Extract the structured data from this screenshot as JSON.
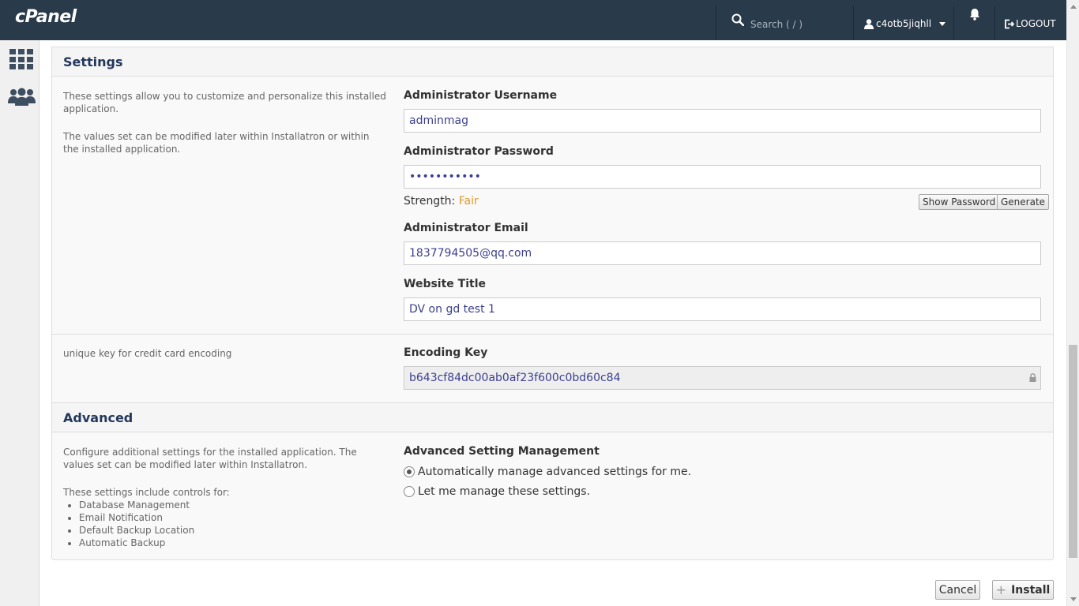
{
  "topbar": {
    "logo": "cPanel",
    "search_placeholder": "Search ( / )",
    "username": "c4otb5jiqhll",
    "logout_label": "LOGOUT"
  },
  "settings": {
    "heading": "Settings",
    "desc_1": "These settings allow you to customize and personalize this installed application.",
    "desc_2": "The values set can be modified later within Installatron or within the installed application.",
    "admin_username_label": "Administrator Username",
    "admin_username_value": "adminmag",
    "admin_password_label": "Administrator Password",
    "admin_password_value": "•••••••••••",
    "strength_label": "Strength:",
    "strength_value": "Fair",
    "show_password_label": "Show Password",
    "generate_label": "Generate",
    "admin_email_label": "Administrator Email",
    "admin_email_value": "1837794505@qq.com",
    "website_title_label": "Website Title",
    "website_title_value": "DV on gd test 1",
    "encoding_desc": "unique key for credit card encoding",
    "encoding_key_label": "Encoding Key",
    "encoding_key_value": "b643cf84dc00ab0af23f600c0bd60c84"
  },
  "advanced": {
    "heading": "Advanced",
    "desc_1": "Configure additional settings for the installed application. The values set can be modified later within Installatron.",
    "desc_2": "These settings include controls for:",
    "items": [
      "Database Management",
      "Email Notification",
      "Default Backup Location",
      "Automatic Backup"
    ],
    "management_label": "Advanced Setting Management",
    "option_auto": "Automatically manage advanced settings for me.",
    "option_manual": "Let me manage these settings."
  },
  "footer": {
    "cancel_label": "Cancel",
    "install_label": "Install"
  }
}
